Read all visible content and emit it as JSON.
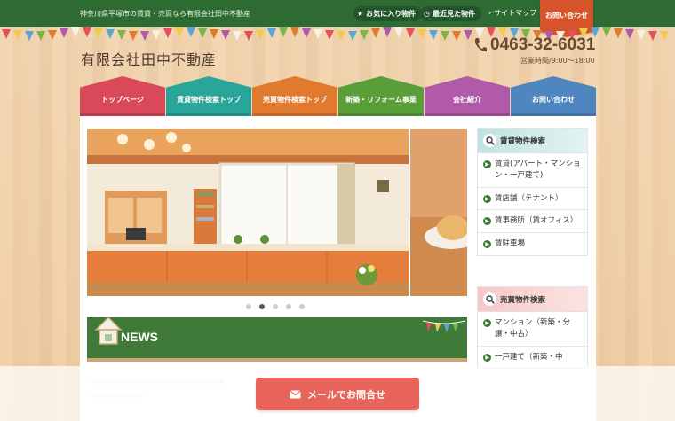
{
  "topbar": {
    "tagline": "神奈川県平塚市の賃貸・売買なら有限会社田中不動産",
    "favorites": "お気に入り物件",
    "recent": "最近見た物件",
    "sitemap": "サイトマップ",
    "contact": "お問い合わせ"
  },
  "header": {
    "site_title": "有限会社田中不動産",
    "phone": "0463-32-6031",
    "hours": "営業時間/9:00～18:00"
  },
  "nav": [
    {
      "label": "トップページ",
      "color": "#d9495a"
    },
    {
      "label": "賃貸物件検索トップ",
      "color": "#2aa59a"
    },
    {
      "label": "売買物件検索トップ",
      "color": "#e07a2e"
    },
    {
      "label": "新築・リフォーム事業",
      "color": "#5a9e3a"
    },
    {
      "label": "会社紹介",
      "color": "#b05aa8"
    },
    {
      "label": "お問い合わせ",
      "color": "#4f86c0"
    }
  ],
  "slider": {
    "active_index": 1,
    "count": 5
  },
  "news": {
    "title": "NEWS"
  },
  "sidebar": {
    "rent": {
      "heading": "賃貸物件検索",
      "items": [
        "賃貸(アパート・マンション・一戸建て)",
        "賃店舗（テナント）",
        "賃事務所（賃オフィス）",
        "賃駐車場"
      ]
    },
    "sale": {
      "heading": "売買物件検索",
      "items": [
        "マンション（新築・分譲・中古）",
        "一戸建て（新築・中"
      ]
    }
  },
  "mail_button": {
    "label": "メールでお問合せ"
  },
  "colors": {
    "topbar": "#2e6b33",
    "accent": "#d6542c",
    "mail": "#e8645a"
  }
}
